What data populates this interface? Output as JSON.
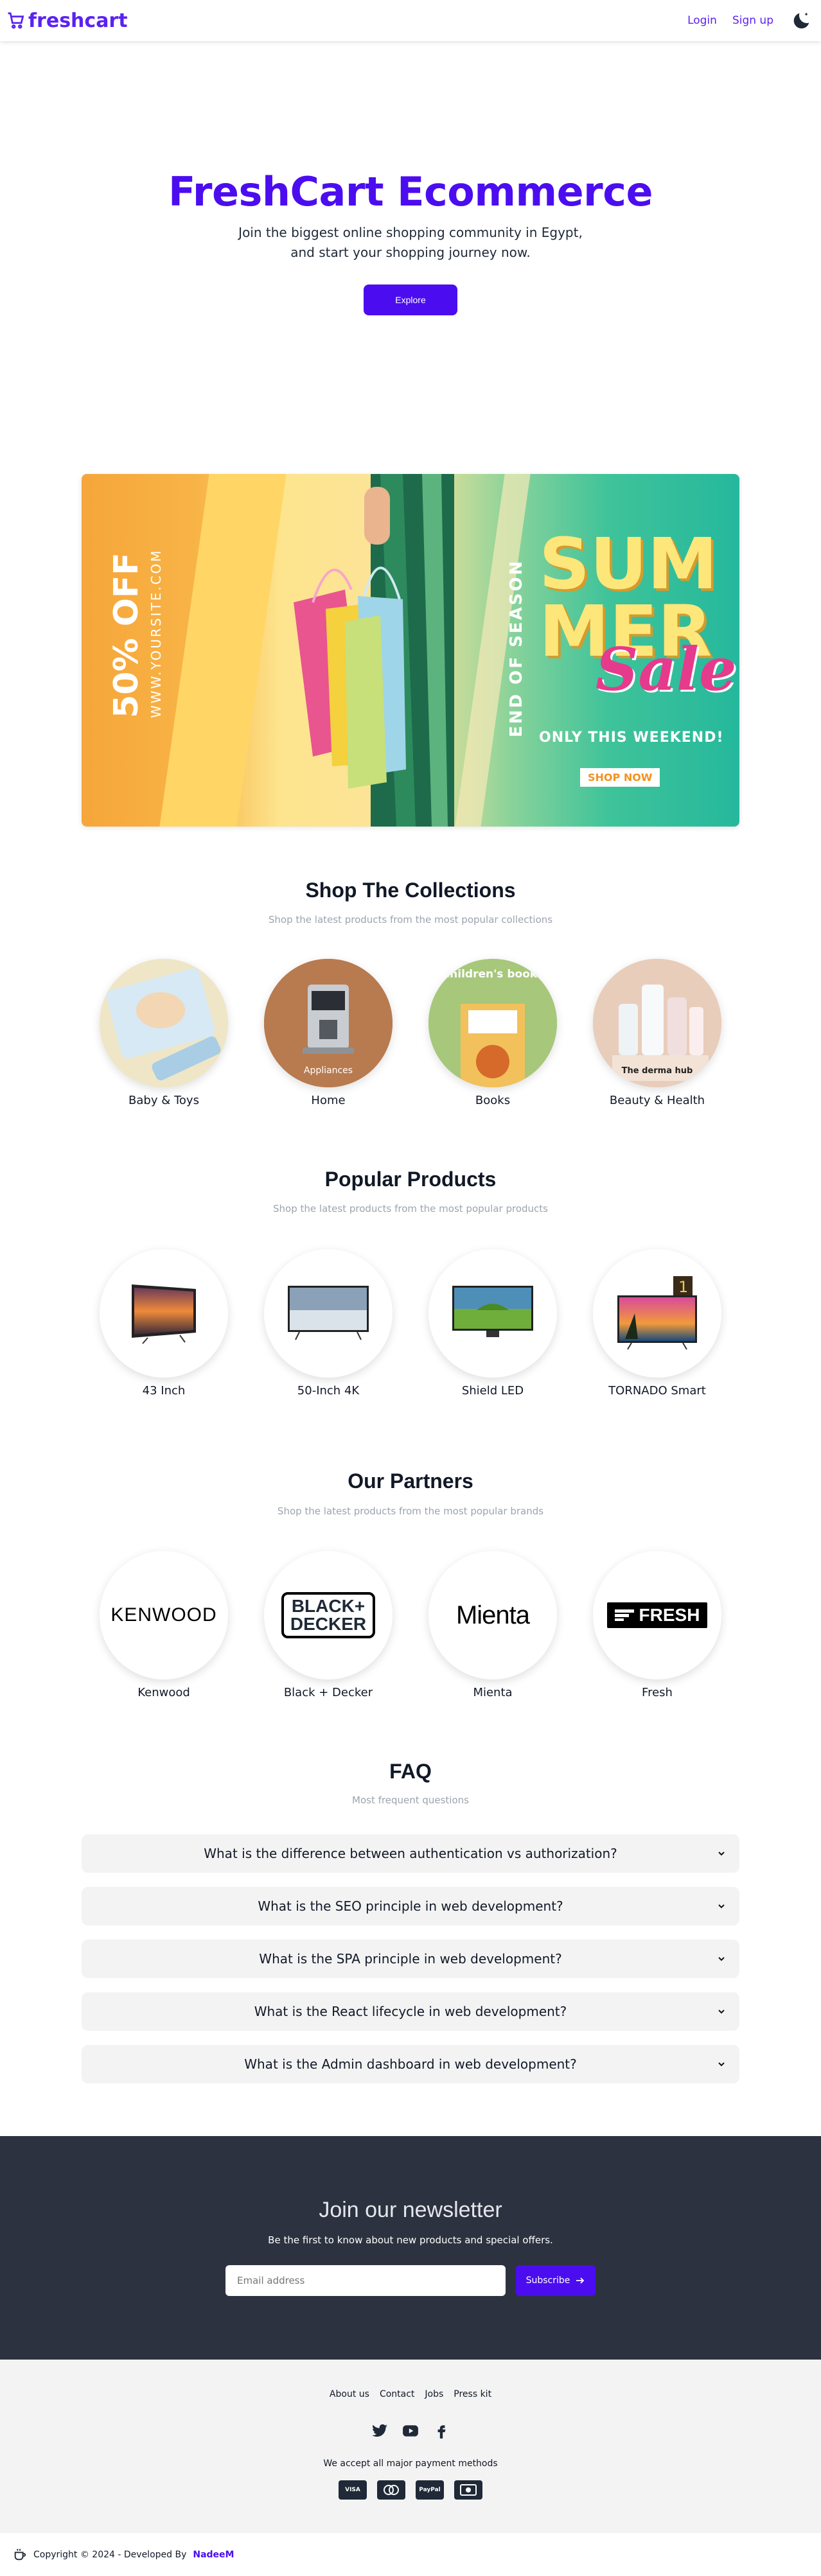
{
  "nav": {
    "brand": "freshcart",
    "login": "Login",
    "signup": "Sign up",
    "theme_icon": "moon-icon"
  },
  "hero": {
    "title": "FreshCart Ecommerce",
    "subtitle": "Join the biggest online shopping community in Egypt, and start your shopping journey now.",
    "button": "Explore"
  },
  "banner": {
    "off_text": "50% OFF",
    "site_text": "WWW.YOURSITE.COM",
    "eos_text": "END OF SEASON",
    "sum": "SUM",
    "mer": "MER",
    "sale": "Sale",
    "weekend": "ONLY THIS WEEKEND!",
    "shop_now": "SHOP NOW"
  },
  "collections": {
    "title": "Shop The Collections",
    "subtitle": "Shop the latest products from the most popular collections",
    "items": [
      {
        "label": "Baby & Toys",
        "overlay": ""
      },
      {
        "label": "Home",
        "overlay": "Appliances"
      },
      {
        "label": "Books",
        "overlay": "Children's books"
      },
      {
        "label": "Beauty & Health",
        "overlay": "The derma hub"
      }
    ]
  },
  "products": {
    "title": "Popular Products",
    "subtitle": "Shop the latest products from the most popular products",
    "items": [
      {
        "label": "43 Inch"
      },
      {
        "label": "50-Inch 4K"
      },
      {
        "label": "Shield LED"
      },
      {
        "label": "TORNADO Smart"
      }
    ]
  },
  "partners": {
    "title": "Our Partners",
    "subtitle": "Shop the latest products from the most popular brands",
    "items": [
      {
        "label": "Kenwood",
        "logo": "KENWOOD"
      },
      {
        "label": "Black + Decker",
        "logo_line1": "BLACK+",
        "logo_line2": "DECKER"
      },
      {
        "label": "Mienta",
        "logo": "Mienta"
      },
      {
        "label": "Fresh",
        "logo": "FRESH"
      }
    ]
  },
  "faq": {
    "title": "FAQ",
    "subtitle": "Most frequent questions",
    "items": [
      "What is the difference between authentication vs authorization?",
      "What is the SEO principle in web development?",
      "What is the SPA principle in web development?",
      "What is the React lifecycle in web development?",
      "What is the Admin dashboard in web development?"
    ]
  },
  "newsletter": {
    "title": "Join our newsletter",
    "text": "Be the first to know about new products and special offers.",
    "placeholder": "Email address",
    "button": "Subscribe"
  },
  "footer": {
    "links": [
      "About us",
      "Contact",
      "Jobs",
      "Press kit"
    ],
    "payments_text": "We accept all major payment methods",
    "payments": [
      "VISA",
      "",
      "PayPal",
      ""
    ],
    "copyright": "Copyright © 2024 - Developed By",
    "developer": "NadeeM"
  },
  "colors": {
    "primary": "#4b0df0",
    "dark": "#2d3240"
  }
}
